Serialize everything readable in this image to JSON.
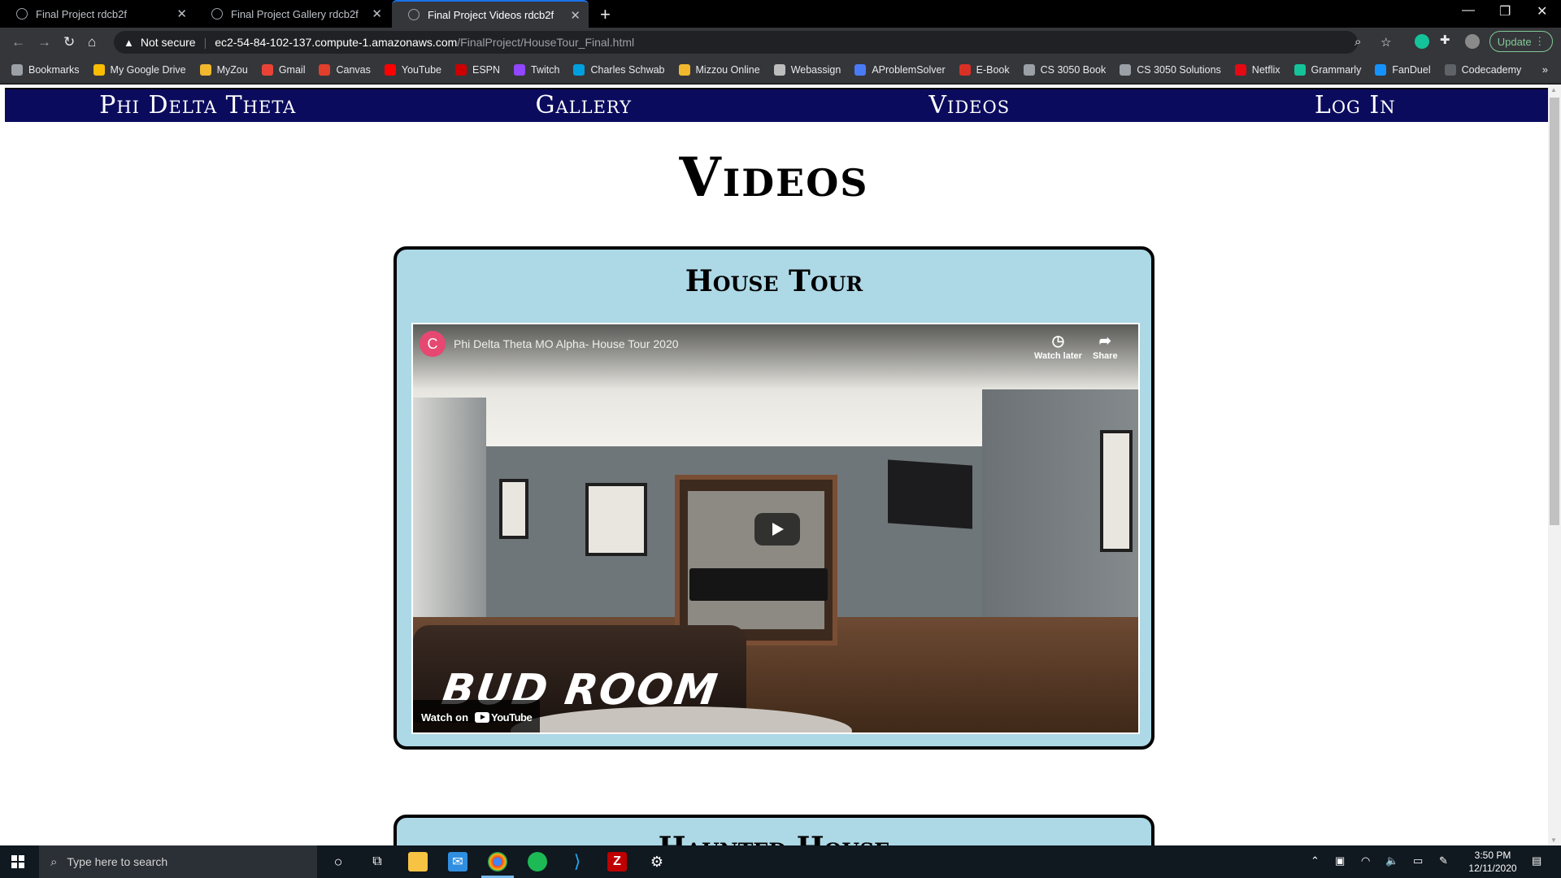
{
  "browser": {
    "tabs": [
      {
        "title": "Final Project rdcb2f",
        "active": false
      },
      {
        "title": "Final Project Gallery rdcb2f",
        "active": false
      },
      {
        "title": "Final Project Videos rdcb2f",
        "active": true
      }
    ],
    "security_label": "Not secure",
    "url_host": "ec2-54-84-102-137.compute-1.amazonaws.com",
    "url_path": "/FinalProject/HouseTour_Final.html",
    "update_label": "Update",
    "bookmarks": [
      {
        "label": "Bookmarks",
        "icon": "star-icon",
        "color": "#9aa0a6"
      },
      {
        "label": "My Google Drive",
        "icon": "google-drive-icon",
        "color": "#fbbc04"
      },
      {
        "label": "MyZou",
        "icon": "myzou-icon",
        "color": "#f1b82d"
      },
      {
        "label": "Gmail",
        "icon": "gmail-icon",
        "color": "#ea4335"
      },
      {
        "label": "Canvas",
        "icon": "canvas-icon",
        "color": "#e13f2b"
      },
      {
        "label": "YouTube",
        "icon": "youtube-icon",
        "color": "#ff0000"
      },
      {
        "label": "ESPN",
        "icon": "espn-icon",
        "color": "#cc0000"
      },
      {
        "label": "Twitch",
        "icon": "twitch-icon",
        "color": "#9146ff"
      },
      {
        "label": "Charles Schwab",
        "icon": "schwab-icon",
        "color": "#00a0df"
      },
      {
        "label": "Mizzou Online",
        "icon": "mizzou-icon",
        "color": "#f1b82d"
      },
      {
        "label": "Webassign",
        "icon": "webassign-icon",
        "color": "#bdbdbd"
      },
      {
        "label": "AProblemSolver",
        "icon": "aproblemsolver-icon",
        "color": "#4a7bf7"
      },
      {
        "label": "E-Book",
        "icon": "ebook-icon",
        "color": "#d93025"
      },
      {
        "label": "CS 3050 Book",
        "icon": "globe-icon",
        "color": "#9aa0a6"
      },
      {
        "label": "CS 3050 Solutions",
        "icon": "solutions-icon",
        "color": "#9aa0a6"
      },
      {
        "label": "Netflix",
        "icon": "netflix-icon",
        "color": "#e50914"
      },
      {
        "label": "Grammarly",
        "icon": "grammarly-icon",
        "color": "#15c39a"
      },
      {
        "label": "FanDuel",
        "icon": "fanduel-icon",
        "color": "#1493ff"
      },
      {
        "label": "Codecademy",
        "icon": "codecademy-icon",
        "color": "#5f6368"
      }
    ]
  },
  "site": {
    "nav": [
      {
        "label": "Phi Delta Theta"
      },
      {
        "label": "Gallery"
      },
      {
        "label": "Videos"
      },
      {
        "label": "Log In"
      }
    ],
    "nav_color": "#0b0b5e",
    "page_title": "Videos",
    "card_color": "#add8e6",
    "cards": [
      {
        "title": "House Tour",
        "video": {
          "channel_initial": "C",
          "title": "Phi Delta Theta MO Alpha- House Tour 2020",
          "watch_later": "Watch later",
          "share": "Share",
          "overlay_caption": "BUD ROOM",
          "watch_on": "Watch on",
          "youtube": "YouTube"
        }
      },
      {
        "title": "Haunted House"
      }
    ]
  },
  "taskbar": {
    "search_placeholder": "Type here to search",
    "time": "3:50 PM",
    "date": "12/11/2020"
  }
}
